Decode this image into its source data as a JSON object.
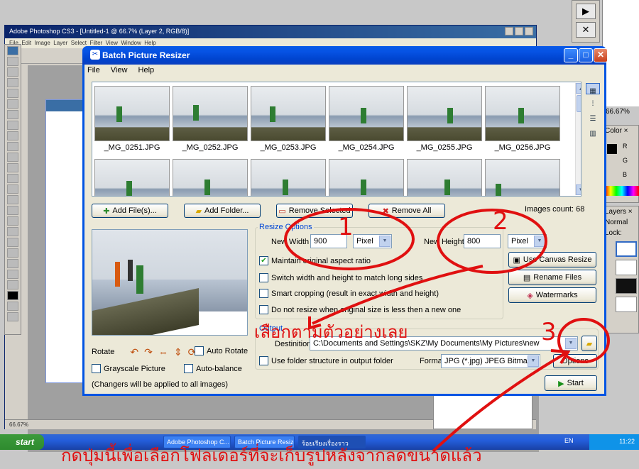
{
  "photoshop": {
    "title": "Adobe Photoshop CS3 - [Untitled-1 @ 66.7% (Layer 2, RGB/8)]",
    "menu": [
      "File",
      "Edit",
      "Image",
      "Layer",
      "Select",
      "Filter",
      "View",
      "Window",
      "Help"
    ],
    "zoom_status": "66.67%",
    "zoom_panel": "66.67%",
    "color_tab": "Color",
    "layers_tab": "Layers",
    "blend_mode": "Normal",
    "lock_label": "Lock:",
    "rgb": [
      "R",
      "G",
      "B"
    ]
  },
  "taskbar": {
    "start": "start",
    "tasks": [
      "Adobe Photoshop C...",
      "Batch Picture Resize...",
      "ร้อยเรียงเรื่องราว"
    ],
    "lang": "EN",
    "clock": "11:22"
  },
  "dialog": {
    "title": "Batch Picture Resizer",
    "menu": [
      "File",
      "View",
      "Help"
    ],
    "thumbnails": [
      "_MG_0251.JPG",
      "_MG_0252.JPG",
      "_MG_0253.JPG",
      "_MG_0254.JPG",
      "_MG_0255.JPG",
      "_MG_0256.JPG"
    ],
    "buttons": {
      "add_files": "Add File(s)...",
      "add_folder": "Add Folder...",
      "remove_selected": "Remove Selected",
      "remove_all": "Remove All"
    },
    "images_count": "Images count: 68",
    "resize_options": {
      "title": "Resize Options",
      "width_label": "New Width",
      "width_value": "900",
      "width_unit": "Pixel",
      "height_label": "New Height",
      "height_value": "800",
      "height_unit": "Pixel",
      "maintain_aspect": "Maintain original aspect ratio",
      "switch_wh": "Switch width and height to match long sides",
      "smart_crop": "Smart cropping (result in exact width and height)",
      "no_resize": "Do not resize when original size is less then a new one"
    },
    "side_buttons": {
      "canvas": "Use Canvas Resize",
      "rename": "Rename Files",
      "watermarks": "Watermarks"
    },
    "rotate_label": "Rotate",
    "auto_rotate": "Auto Rotate",
    "grayscale": "Grayscale Picture",
    "auto_balance": "Auto-balance",
    "changes_note": "(Changers will be applied to all images)",
    "output": {
      "title": "Output",
      "destination_label": "Destinition",
      "destination_value": "C:\\Documents and Settings\\SKZ\\My Documents\\My Pictures\\new",
      "folder_structure": "Use folder structure in output folder",
      "format_label": "Format",
      "format_value": "JPG (*.jpg) JPEG Bitmap",
      "options_button": "Options",
      "start_button": "Start"
    }
  },
  "annotations": {
    "num1": "1",
    "num2": "2",
    "num3": "3",
    "text_middle": "เลือกตามตัวอย่างเลย",
    "text_bottom": "กดปุ่มนี้เพื่อเลือกโฟลเดอร์ที่จะเก็บรูปหลังจากลดขนาดแล้ว",
    "color": "#e01010"
  }
}
